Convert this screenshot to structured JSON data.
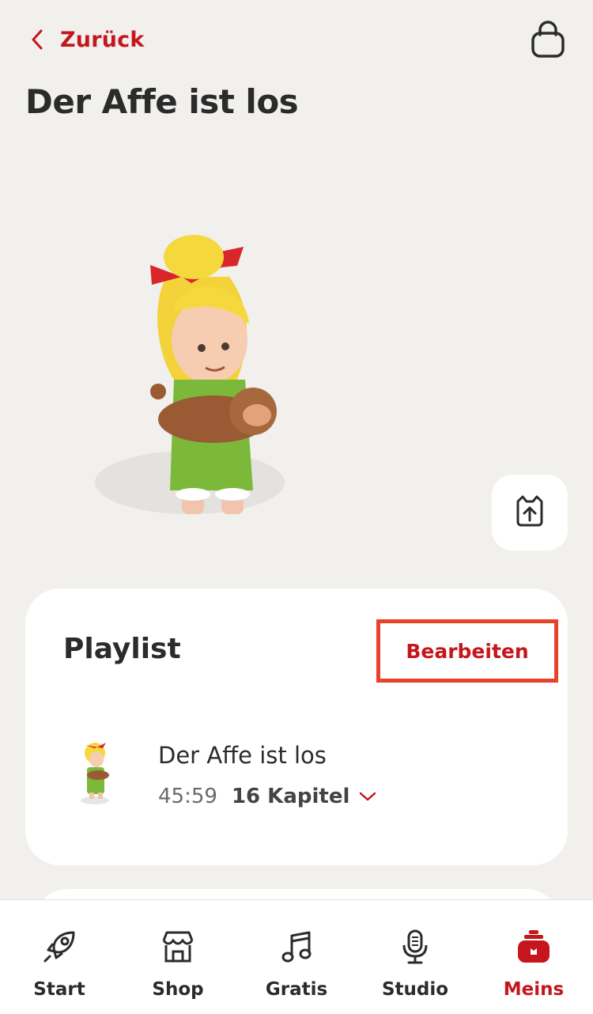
{
  "header": {
    "back_label": "Zurück",
    "back_icon": "chevron-left-icon",
    "bag_icon": "shopping-bag-icon",
    "title": "Der Affe ist los"
  },
  "hero": {
    "image": "figure-character-with-monkey",
    "upload_icon": "box-upload-icon"
  },
  "playlist": {
    "title": "Playlist",
    "edit_label": "Bearbeiten",
    "tracks": [
      {
        "name": "Der Affe ist los",
        "duration": "45:59",
        "chapters": "16 Kapitel"
      }
    ]
  },
  "tabs": [
    {
      "label": "Start",
      "icon": "rocket-icon",
      "active": false
    },
    {
      "label": "Shop",
      "icon": "store-icon",
      "active": false
    },
    {
      "label": "Gratis",
      "icon": "music-note-icon",
      "active": false
    },
    {
      "label": "Studio",
      "icon": "microphone-icon",
      "active": false
    },
    {
      "label": "Meins",
      "icon": "toniebox-icon",
      "active": true
    }
  ],
  "colors": {
    "accent": "#c4161c",
    "highlight_border": "#e8422a",
    "background": "#f1f0ed"
  }
}
